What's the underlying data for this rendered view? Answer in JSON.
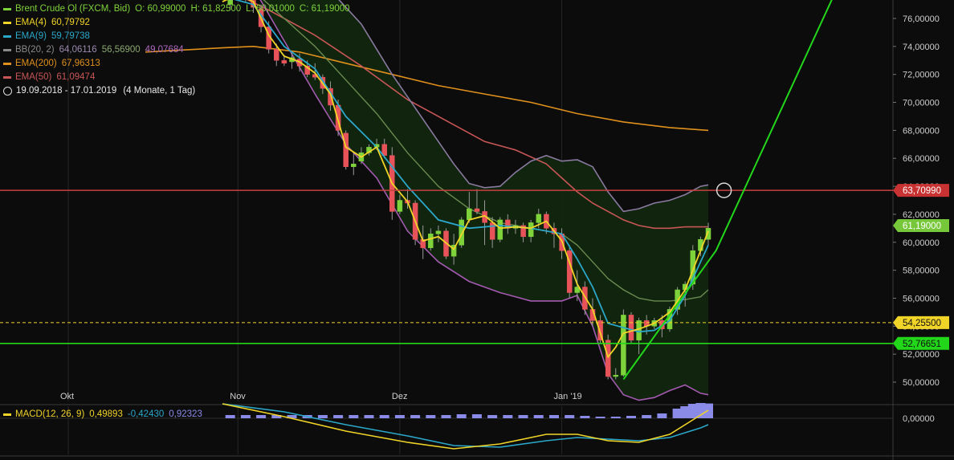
{
  "colors": {
    "background": "#0c0c0c",
    "up": "#7ed23a",
    "down": "#e8535a",
    "ema4": "#f0d428",
    "ema9": "#2aa7c9",
    "bb_upper": "#8a7aa0",
    "bb_mid": "#6a8a50",
    "bb_lower": "#a35ab0",
    "bb_fill": "#12260f",
    "ema200": "#e0901c",
    "ema50": "#c85656",
    "trend": "#22d61a",
    "grid": "#262626",
    "axis_text": "#cfcfcf"
  },
  "legend": [
    {
      "name": "Brent Crude Ol (FXCM, Bid)",
      "values": [
        "O: 60,99000",
        "H: 61,82500",
        "L: 60,01000",
        "C: 61,19000"
      ],
      "color": "#7ed23a"
    },
    {
      "name": "EMA(4)",
      "values": [
        "60,79792"
      ],
      "color": "#f0d428"
    },
    {
      "name": "EMA(9)",
      "values": [
        "59,79738"
      ],
      "color": "#2aa7c9"
    },
    {
      "name": "BB(20, 2)",
      "values": [
        "64,06116",
        "56,56900",
        "49,07684"
      ],
      "color": "#8a8a8a",
      "value_colors": [
        "#9a8aaf",
        "#8aa870",
        "#b06abf"
      ]
    },
    {
      "name": "EMA(200)",
      "values": [
        "67,96313"
      ],
      "color": "#e0901c"
    },
    {
      "name": "EMA(50)",
      "values": [
        "61,09474"
      ],
      "color": "#c85656"
    }
  ],
  "date_range": "19.09.2018 - 17.01.2019",
  "period": "(4 Monate, 1 Tag)",
  "macd_legend": {
    "name": "MACD(12, 26, 9)",
    "values": [
      "0,49893",
      "-0,42430",
      "0,92323"
    ],
    "colors": [
      "#f0d428",
      "#2aa7c9",
      "#8a8ae8"
    ]
  },
  "chart_data": {
    "type": "candlestick",
    "title": "Brent Crude Ol (FXCM, Bid)",
    "x_labels": [
      {
        "label": "Okt",
        "index": 0
      },
      {
        "label": "Nov",
        "index": 22
      },
      {
        "label": "Dez",
        "index": 43
      },
      {
        "label": "Jan '19",
        "index": 64
      }
    ],
    "y_ticks": [
      "76,00000",
      "74,00000",
      "72,00000",
      "70,00000",
      "68,00000",
      "66,00000",
      "64,00000",
      "62,00000",
      "60,00000",
      "58,00000",
      "56,00000",
      "54,00000",
      "52,00000",
      "50,00000"
    ],
    "y_tick_values": [
      76,
      74,
      72,
      70,
      68,
      66,
      64,
      62,
      60,
      58,
      56,
      54,
      52,
      50
    ],
    "ylim": [
      48.3,
      78.5
    ],
    "macd_ylim": [
      -2.4,
      1.0
    ],
    "macd_ticks": [
      {
        "label": "0,00000",
        "value": 0
      }
    ],
    "x_count": 84,
    "candles": [
      [
        21,
        77.0,
        78.5,
        76.6,
        77.8
      ],
      [
        22,
        77.8,
        78.6,
        77.4,
        78.1
      ],
      [
        23,
        78.2,
        78.5,
        77.2,
        77.4
      ],
      [
        24,
        77.3,
        77.6,
        76.4,
        76.8
      ],
      [
        25,
        76.7,
        77.0,
        75.0,
        75.4
      ],
      [
        26,
        75.4,
        75.8,
        73.5,
        73.8
      ],
      [
        27,
        73.8,
        74.2,
        72.6,
        73.0
      ],
      [
        28,
        73.0,
        73.4,
        72.6,
        72.8
      ],
      [
        29,
        72.9,
        73.6,
        72.4,
        73.2
      ],
      [
        30,
        73.1,
        73.5,
        72.2,
        72.6
      ],
      [
        31,
        72.6,
        73.0,
        71.8,
        72.0
      ],
      [
        32,
        72.0,
        72.8,
        71.6,
        71.8
      ],
      [
        33,
        71.8,
        72.0,
        70.6,
        71.0
      ],
      [
        34,
        71.0,
        71.5,
        69.4,
        69.8
      ],
      [
        35,
        69.8,
        70.2,
        67.6,
        68.0
      ],
      [
        36,
        67.8,
        68.0,
        65.2,
        65.4
      ],
      [
        37,
        65.4,
        66.4,
        64.8,
        65.6
      ],
      [
        38,
        65.8,
        66.8,
        65.6,
        66.4
      ],
      [
        39,
        66.4,
        67.0,
        66.2,
        66.8
      ],
      [
        40,
        66.8,
        67.4,
        66.6,
        67.0
      ],
      [
        41,
        67.0,
        67.4,
        66.0,
        66.2
      ],
      [
        42,
        66.2,
        66.8,
        61.6,
        62.2
      ],
      [
        43,
        62.2,
        63.4,
        62.0,
        63.0
      ],
      [
        44,
        63.0,
        63.8,
        62.4,
        62.8
      ],
      [
        45,
        62.8,
        63.0,
        59.8,
        60.2
      ],
      [
        46,
        60.2,
        61.2,
        58.8,
        59.6
      ],
      [
        47,
        59.6,
        61.0,
        59.4,
        60.6
      ],
      [
        48,
        60.6,
        61.2,
        60.0,
        60.8
      ],
      [
        49,
        60.8,
        61.0,
        58.8,
        59.0
      ],
      [
        50,
        59.0,
        60.6,
        58.4,
        59.8
      ],
      [
        51,
        59.8,
        61.8,
        59.6,
        61.6
      ],
      [
        52,
        61.6,
        63.6,
        61.4,
        62.4
      ],
      [
        53,
        62.4,
        63.8,
        62.0,
        62.2
      ],
      [
        54,
        62.2,
        63.0,
        59.8,
        61.4
      ],
      [
        55,
        61.4,
        61.8,
        59.6,
        60.2
      ],
      [
        56,
        60.2,
        61.8,
        60.0,
        61.6
      ],
      [
        57,
        61.6,
        62.0,
        60.6,
        61.0
      ],
      [
        58,
        61.0,
        61.6,
        60.6,
        61.2
      ],
      [
        59,
        61.2,
        61.4,
        60.0,
        60.4
      ],
      [
        60,
        60.4,
        61.6,
        60.0,
        61.4
      ],
      [
        61,
        61.4,
        62.4,
        61.0,
        62.0
      ],
      [
        62,
        62.0,
        62.2,
        60.6,
        61.0
      ],
      [
        63,
        61.0,
        61.4,
        59.6,
        60.6
      ],
      [
        64,
        60.6,
        61.0,
        58.8,
        59.4
      ],
      [
        65,
        59.4,
        59.8,
        56.0,
        56.4
      ],
      [
        66,
        56.4,
        58.0,
        55.8,
        56.8
      ],
      [
        67,
        56.8,
        57.2,
        54.8,
        55.2
      ],
      [
        68,
        55.2,
        56.0,
        54.0,
        54.4
      ],
      [
        69,
        54.4,
        54.8,
        52.8,
        53.0
      ],
      [
        70,
        53.0,
        53.4,
        50.2,
        50.4
      ],
      [
        71,
        50.4,
        51.0,
        50.2,
        50.5
      ],
      [
        72,
        50.5,
        55.2,
        50.4,
        54.8
      ],
      [
        73,
        54.8,
        55.0,
        52.8,
        53.0
      ],
      [
        74,
        53.0,
        54.6,
        52.0,
        54.4
      ],
      [
        75,
        54.4,
        54.8,
        53.4,
        54.0
      ],
      [
        76,
        54.0,
        54.6,
        53.8,
        54.4
      ],
      [
        77,
        54.4,
        54.8,
        53.2,
        53.8
      ],
      [
        78,
        53.8,
        55.4,
        53.6,
        55.2
      ],
      [
        79,
        55.2,
        56.8,
        54.8,
        56.6
      ],
      [
        80,
        56.6,
        57.2,
        55.4,
        57.0
      ],
      [
        81,
        57.0,
        59.8,
        56.6,
        59.4
      ],
      [
        82,
        59.4,
        60.4,
        59.0,
        60.2
      ],
      [
        83,
        60.2,
        61.4,
        59.8,
        61.0
      ]
    ],
    "ema4": [
      [
        20,
        77.2
      ],
      [
        22,
        77.7
      ],
      [
        24,
        77.2
      ],
      [
        26,
        74.8
      ],
      [
        28,
        73.3
      ],
      [
        30,
        72.9
      ],
      [
        32,
        72.1
      ],
      [
        34,
        70.6
      ],
      [
        36,
        66.8
      ],
      [
        38,
        66.1
      ],
      [
        40,
        66.8
      ],
      [
        42,
        64.2
      ],
      [
        44,
        62.9
      ],
      [
        46,
        60.1
      ],
      [
        48,
        60.4
      ],
      [
        50,
        59.5
      ],
      [
        52,
        61.6
      ],
      [
        54,
        61.9
      ],
      [
        56,
        61.0
      ],
      [
        58,
        61.1
      ],
      [
        60,
        61.0
      ],
      [
        62,
        61.5
      ],
      [
        64,
        60.1
      ],
      [
        66,
        57.0
      ],
      [
        68,
        55.2
      ],
      [
        70,
        51.8
      ],
      [
        71,
        52.5
      ],
      [
        72,
        53.5
      ],
      [
        74,
        53.8
      ],
      [
        76,
        54.2
      ],
      [
        78,
        55.0
      ],
      [
        80,
        56.6
      ],
      [
        82,
        59.4
      ],
      [
        83,
        60.8
      ]
    ],
    "ema9": [
      [
        20,
        77.6
      ],
      [
        24,
        77.0
      ],
      [
        28,
        74.0
      ],
      [
        32,
        72.4
      ],
      [
        36,
        69.0
      ],
      [
        40,
        66.8
      ],
      [
        44,
        64.0
      ],
      [
        48,
        61.6
      ],
      [
        52,
        61.0
      ],
      [
        56,
        61.2
      ],
      [
        60,
        61.0
      ],
      [
        64,
        60.6
      ],
      [
        66,
        58.8
      ],
      [
        68,
        56.8
      ],
      [
        70,
        54.2
      ],
      [
        72,
        53.9
      ],
      [
        74,
        53.6
      ],
      [
        76,
        53.7
      ],
      [
        78,
        54.4
      ],
      [
        80,
        56.2
      ],
      [
        82,
        58.6
      ],
      [
        83,
        59.8
      ]
    ],
    "bb_upper": [
      [
        20,
        78.5
      ],
      [
        26,
        78.5
      ],
      [
        30,
        78.5
      ],
      [
        34,
        78.0
      ],
      [
        38,
        75.6
      ],
      [
        42,
        72.0
      ],
      [
        46,
        68.8
      ],
      [
        50,
        65.6
      ],
      [
        52,
        64.2
      ],
      [
        54,
        63.9
      ],
      [
        56,
        64.0
      ],
      [
        58,
        65.0
      ],
      [
        60,
        65.8
      ],
      [
        62,
        66.2
      ],
      [
        64,
        65.8
      ],
      [
        66,
        65.9
      ],
      [
        68,
        65.4
      ],
      [
        70,
        63.6
      ],
      [
        72,
        62.2
      ],
      [
        74,
        62.4
      ],
      [
        76,
        62.8
      ],
      [
        78,
        63.0
      ],
      [
        80,
        63.4
      ],
      [
        82,
        64.0
      ],
      [
        83,
        64.1
      ]
    ],
    "bb_mid": [
      [
        20,
        78.5
      ],
      [
        24,
        78.0
      ],
      [
        28,
        76.0
      ],
      [
        32,
        74.0
      ],
      [
        36,
        71.6
      ],
      [
        40,
        69.2
      ],
      [
        44,
        66.4
      ],
      [
        48,
        64.0
      ],
      [
        52,
        62.4
      ],
      [
        56,
        61.4
      ],
      [
        60,
        61.0
      ],
      [
        64,
        60.6
      ],
      [
        66,
        59.8
      ],
      [
        68,
        58.6
      ],
      [
        70,
        57.4
      ],
      [
        72,
        56.6
      ],
      [
        74,
        56.0
      ],
      [
        76,
        55.8
      ],
      [
        78,
        55.8
      ],
      [
        80,
        55.9
      ],
      [
        82,
        56.1
      ],
      [
        83,
        56.6
      ]
    ],
    "bb_lower": [
      [
        20,
        78.5
      ],
      [
        24,
        78.2
      ],
      [
        28,
        74.4
      ],
      [
        32,
        70.6
      ],
      [
        36,
        67.0
      ],
      [
        40,
        64.6
      ],
      [
        44,
        60.8
      ],
      [
        48,
        58.6
      ],
      [
        52,
        57.2
      ],
      [
        56,
        56.4
      ],
      [
        60,
        55.8
      ],
      [
        64,
        55.8
      ],
      [
        66,
        56.2
      ],
      [
        68,
        54.0
      ],
      [
        70,
        50.6
      ],
      [
        72,
        49.1
      ],
      [
        74,
        48.7
      ],
      [
        76,
        48.9
      ],
      [
        78,
        49.4
      ],
      [
        80,
        49.8
      ],
      [
        82,
        49.2
      ],
      [
        83,
        49.1
      ]
    ],
    "ema200": [
      [
        10,
        73.6
      ],
      [
        20,
        73.9
      ],
      [
        24,
        74.0
      ],
      [
        30,
        73.6
      ],
      [
        36,
        72.8
      ],
      [
        42,
        72.0
      ],
      [
        48,
        71.2
      ],
      [
        54,
        70.6
      ],
      [
        60,
        70.0
      ],
      [
        66,
        69.2
      ],
      [
        72,
        68.6
      ],
      [
        78,
        68.2
      ],
      [
        83,
        68.0
      ]
    ],
    "ema50": [
      [
        20,
        78.2
      ],
      [
        26,
        76.6
      ],
      [
        32,
        74.8
      ],
      [
        38,
        72.6
      ],
      [
        44,
        70.2
      ],
      [
        50,
        68.4
      ],
      [
        54,
        67.2
      ],
      [
        58,
        66.6
      ],
      [
        62,
        65.6
      ],
      [
        64,
        64.6
      ],
      [
        66,
        63.6
      ],
      [
        68,
        62.8
      ],
      [
        70,
        62.2
      ],
      [
        72,
        61.6
      ],
      [
        74,
        61.2
      ],
      [
        76,
        61.0
      ],
      [
        78,
        61.0
      ],
      [
        80,
        61.1
      ],
      [
        83,
        61.1
      ]
    ],
    "trendline": [
      [
        72,
        50.2
      ],
      [
        84,
        59.4
      ],
      [
        100,
        78.5
      ]
    ],
    "horizontal_lines": [
      {
        "value": 63.7099,
        "label": "63,70990",
        "color": "#c84040",
        "box": "#c83232",
        "text": "#ffffff",
        "style": "solid"
      },
      {
        "value": 61.19,
        "label": "61,19000",
        "color": null,
        "box": "#76c83a",
        "text": "#ffffff",
        "style": "none"
      },
      {
        "value": 54.255,
        "label": "54,25500",
        "color": "#f0d428",
        "box": "#f0d428",
        "text": "#111111",
        "style": "dashed"
      },
      {
        "value": 52.76651,
        "label": "52,76651",
        "color": "#22d61a",
        "box": "#22d61a",
        "text": "#111111",
        "style": "solid"
      }
    ],
    "macd_line": [
      [
        20,
        0.9
      ],
      [
        28,
        0.1
      ],
      [
        36,
        -0.8
      ],
      [
        44,
        -1.5
      ],
      [
        50,
        -1.9
      ],
      [
        56,
        -1.6
      ],
      [
        62,
        -1.0
      ],
      [
        66,
        -1.0
      ],
      [
        70,
        -1.4
      ],
      [
        74,
        -1.5
      ],
      [
        78,
        -1.0
      ],
      [
        82,
        0.2
      ],
      [
        83,
        0.5
      ]
    ],
    "macd_signal": [
      [
        20,
        0.9
      ],
      [
        28,
        0.4
      ],
      [
        36,
        -0.4
      ],
      [
        44,
        -1.1
      ],
      [
        50,
        -1.7
      ],
      [
        56,
        -1.8
      ],
      [
        62,
        -1.4
      ],
      [
        66,
        -1.2
      ],
      [
        70,
        -1.3
      ],
      [
        74,
        -1.4
      ],
      [
        78,
        -1.2
      ],
      [
        82,
        -0.6
      ],
      [
        83,
        -0.4
      ]
    ],
    "macd_hist": [
      [
        21,
        0.2
      ],
      [
        23,
        0.2
      ],
      [
        25,
        0.2
      ],
      [
        27,
        0.2
      ],
      [
        29,
        0.2
      ],
      [
        31,
        0.2
      ],
      [
        33,
        0.2
      ],
      [
        35,
        0.2
      ],
      [
        37,
        0.2
      ],
      [
        39,
        0.2
      ],
      [
        41,
        0.2
      ],
      [
        43,
        0.2
      ],
      [
        45,
        0.2
      ],
      [
        47,
        0.2
      ],
      [
        49,
        0.2
      ],
      [
        51,
        0.25
      ],
      [
        53,
        0.25
      ],
      [
        55,
        0.2
      ],
      [
        57,
        0.2
      ],
      [
        59,
        0.2
      ],
      [
        61,
        0.2
      ],
      [
        63,
        0.2
      ],
      [
        65,
        0.2
      ],
      [
        67,
        0.15
      ],
      [
        69,
        0.1
      ],
      [
        71,
        0.1
      ],
      [
        73,
        0.15
      ],
      [
        75,
        0.2
      ],
      [
        77,
        0.3
      ],
      [
        79,
        0.6
      ],
      [
        80,
        0.75
      ],
      [
        81,
        0.9
      ],
      [
        82,
        0.95
      ],
      [
        83,
        0.92
      ]
    ]
  }
}
